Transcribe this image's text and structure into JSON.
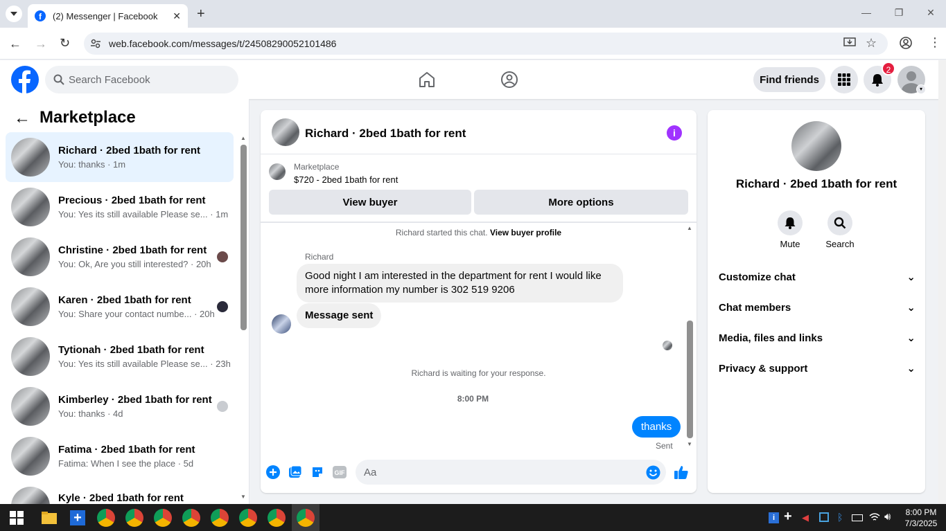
{
  "browser": {
    "tab_title": "(2) Messenger | Facebook",
    "url": "web.facebook.com/messages/t/24508290052101486"
  },
  "header": {
    "search_placeholder": "Search Facebook",
    "find_friends": "Find friends",
    "notification_count": "2"
  },
  "sidebar": {
    "title": "Marketplace",
    "conversations": [
      {
        "name": "Richard · 2bed 1bath for rent",
        "preview": "You: thanks · 1m",
        "active": true
      },
      {
        "name": "Precious · 2bed 1bath for rent",
        "preview": "You: Yes its still available Please se... · 1m"
      },
      {
        "name": "Christine · 2bed 1bath for rent",
        "preview": "You: Ok, Are you still interested? · 20h"
      },
      {
        "name": "Karen · 2bed 1bath for rent",
        "preview": "You: Share your contact numbe... · 20h"
      },
      {
        "name": "Tytionah · 2bed 1bath for rent",
        "preview": "You: Yes its still available Please se... · 23h"
      },
      {
        "name": "Kimberley · 2bed 1bath for rent",
        "preview": "You: thanks · 4d"
      },
      {
        "name": "Fatima · 2bed 1bath for rent",
        "preview": "Fatima: When I see the place · 5d"
      },
      {
        "name": "Kyle · 2bed 1bath for rent",
        "preview": ""
      }
    ]
  },
  "chat": {
    "title": "Richard · 2bed 1bath for rent",
    "listing_source": "Marketplace",
    "listing_price_title": "$720 - 2bed 1bath for rent",
    "view_buyer": "View buyer",
    "more_options": "More options",
    "started_text": "Richard started this chat.",
    "view_buyer_profile": "View buyer profile",
    "sender_name": "Richard",
    "message_1": "Good night I am interested in the department for rent I would like more information my number is 302 519 9206",
    "message_2": "Message sent",
    "waiting_text": "Richard is waiting for your response.",
    "timestamp": "8:00 PM",
    "my_message": "thanks",
    "sent_status": "Sent",
    "composer_placeholder": "Aa"
  },
  "details": {
    "name": "Richard · 2bed 1bath for rent",
    "mute": "Mute",
    "search": "Search",
    "sections": [
      "Customize chat",
      "Chat members",
      "Media, files and links",
      "Privacy & support"
    ]
  },
  "taskbar": {
    "time": "8:00 PM",
    "date": "7/3/2025"
  },
  "colors": {
    "fb_blue": "#0866ff",
    "messenger_blue": "#0084ff",
    "info_purple": "#a033ff",
    "badge_red": "#e41e3f"
  }
}
